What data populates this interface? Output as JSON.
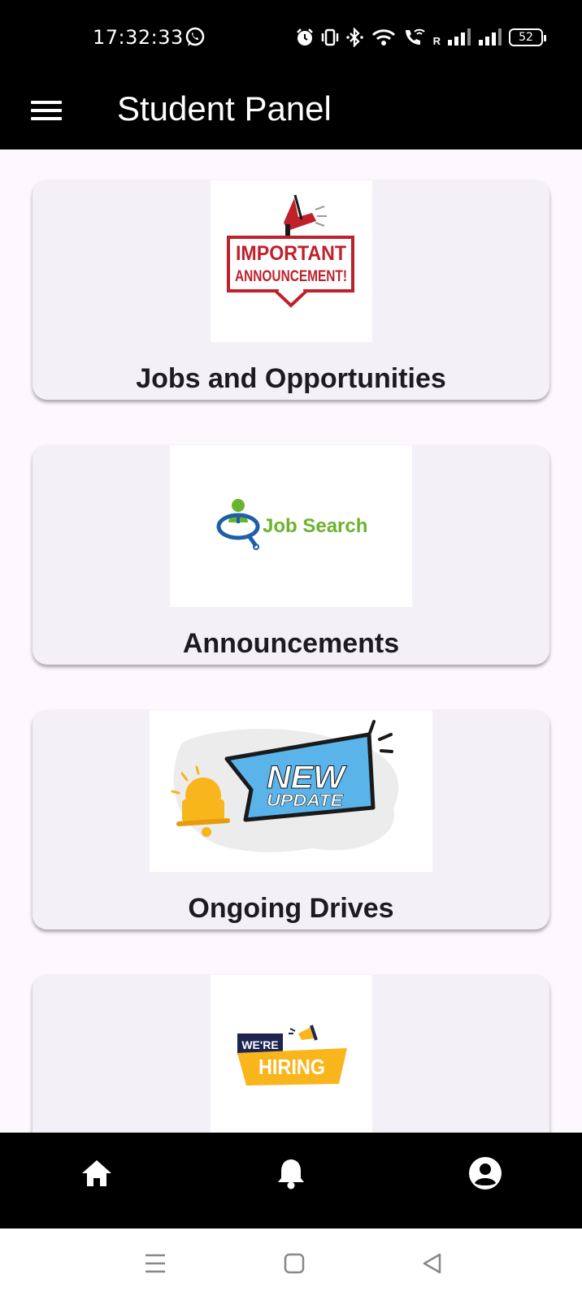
{
  "status_bar": {
    "time": "17:32:33",
    "battery": "52",
    "network_label": "R",
    "icons": [
      "whatsapp-icon",
      "alarm-icon",
      "vibrate-icon",
      "bluetooth-icon",
      "wifi-icon",
      "wifi-calling-icon",
      "signal-icon",
      "signal-icon",
      "battery-icon"
    ]
  },
  "app_bar": {
    "title": "Student Panel",
    "menu_icon": "menu-icon"
  },
  "cards": [
    {
      "label": "Jobs and Opportunities",
      "image_text": [
        "IMPORTANT",
        "ANNOUNCEMENT!"
      ]
    },
    {
      "label": "Announcements",
      "image_text": [
        "Job Search"
      ]
    },
    {
      "label": "Ongoing Drives",
      "image_text": [
        "NEW",
        "UPDATE"
      ]
    },
    {
      "label": "",
      "image_text": [
        "WE'RE",
        "HIRING"
      ]
    }
  ],
  "bottom_nav": {
    "items": [
      "home-icon",
      "bell-icon",
      "account-icon"
    ]
  },
  "system_nav": {
    "items": [
      "recents-icon",
      "home-square-icon",
      "back-icon"
    ]
  },
  "colors": {
    "bars": "#000000",
    "background": "#fcf8fe",
    "card": "#f4f0f7",
    "announcement_red": "#c0202a",
    "job_green": "#6ab42d",
    "job_blue": "#1d5fa8",
    "new_blue": "#5ab4ea",
    "hiring_yellow": "#f9b51c",
    "hiring_navy": "#1d2450"
  }
}
